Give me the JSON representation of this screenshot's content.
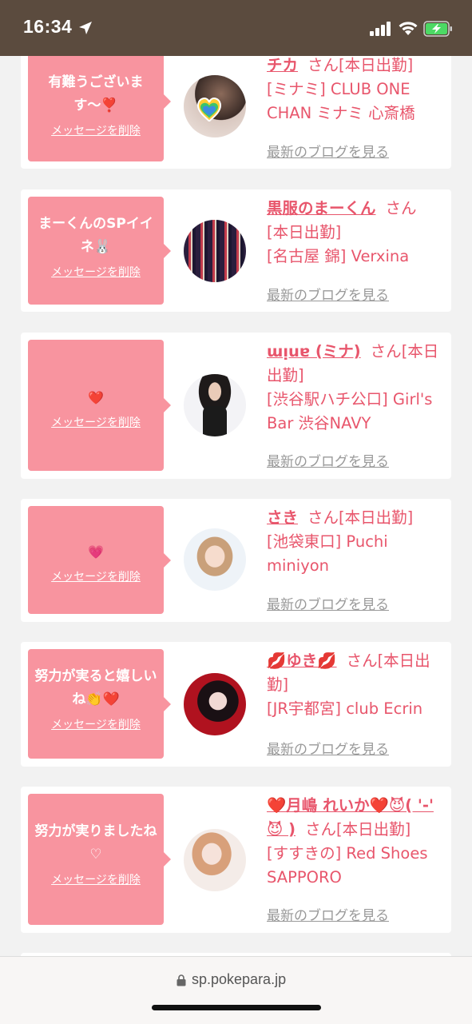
{
  "status": {
    "time": "16:34"
  },
  "browser": {
    "url": "sp.pokepara.jp"
  },
  "cards": [
    {
      "message": "有難うございます〜❣️",
      "delete_label": "メッセージを削除",
      "name": "チカ",
      "suffix": "さん",
      "status": "[本日出勤]",
      "shop": "[ミナミ] CLUB ONE CHAN ミナミ 心斎橋",
      "blog_label": "最新のブログを見る"
    },
    {
      "message": "まーくんのSPイイネ🐰",
      "delete_label": "メッセージを削除",
      "name": "黒服のまーくん",
      "suffix": "さん",
      "status": "[本日出勤]",
      "shop": "[名古屋 錦] Verxina",
      "blog_label": "最新のブログを見る"
    },
    {
      "message": "❤️",
      "delete_label": "メッセージを削除",
      "name": "ɯᴉuɐ (ミナ)",
      "suffix": "さん",
      "status": "[本日出勤]",
      "shop": "[渋谷駅ハチ公口] Girl's Bar 渋谷NAVY",
      "blog_label": "最新のブログを見る"
    },
    {
      "message": "💗",
      "delete_label": "メッセージを削除",
      "name": "さき",
      "suffix": "さん",
      "status": "[本日出勤]",
      "shop": "[池袋東口] Puchi miniyon",
      "blog_label": "最新のブログを見る"
    },
    {
      "message": "努力が実ると嬉しいね👏❤️",
      "delete_label": "メッセージを削除",
      "name": "💋ゆき💋",
      "suffix": "さん",
      "status": "[本日出勤]",
      "shop": "[JR宇都宮] club Ecrin",
      "blog_label": "最新のブログを見る"
    },
    {
      "message": "努力が実りましたね♡",
      "delete_label": "メッセージを削除",
      "name": "❤️月嶋 れいか❤️😈( '-' 😈 )",
      "suffix": "さん",
      "status": "[本日出勤]",
      "shop": "[すすきの] Red Shoes SAPPORO",
      "blog_label": "最新のブログを見る"
    }
  ]
}
